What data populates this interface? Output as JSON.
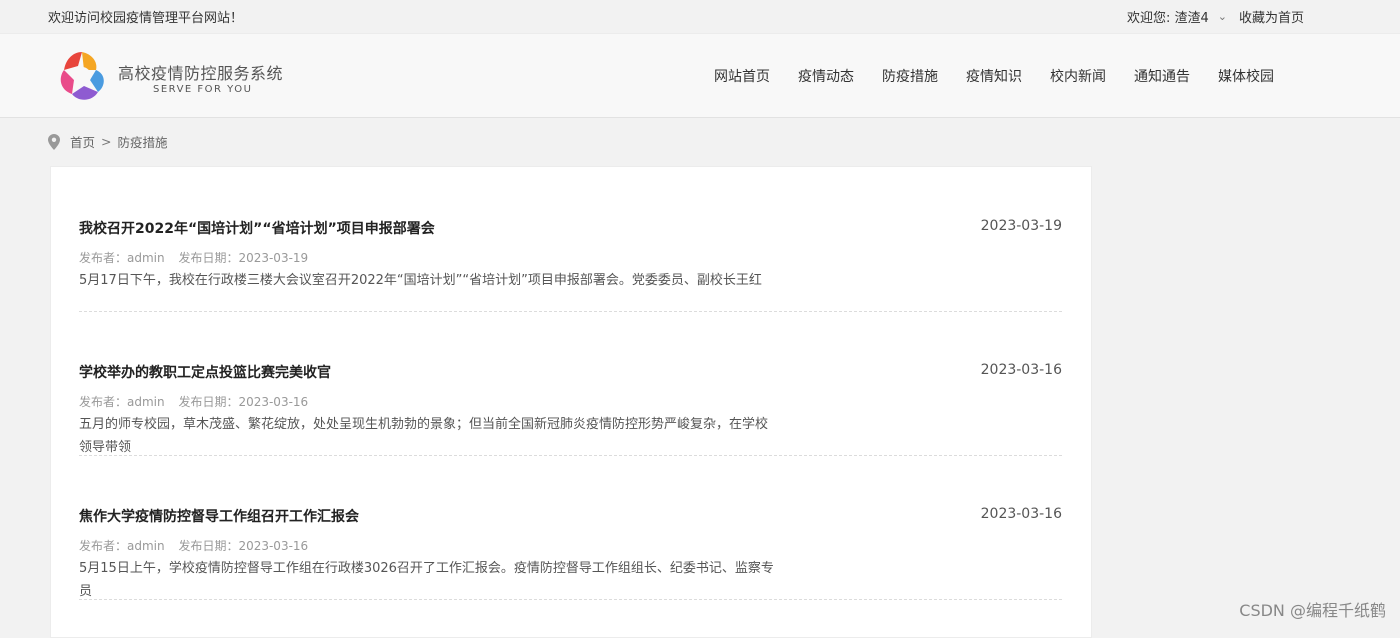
{
  "topbar": {
    "welcome": "欢迎访问校园疫情管理平台网站！",
    "user_greeting": "欢迎您: 渣渣4",
    "favorite": "收藏为首页"
  },
  "brand": {
    "title": "高校疫情防控服务系统",
    "subtitle": "SERVE FOR YOU"
  },
  "nav": {
    "items": [
      "网站首页",
      "疫情动态",
      "防疫措施",
      "疫情知识",
      "校内新闻",
      "通知通告",
      "媒体校园"
    ]
  },
  "breadcrumb": {
    "home": "首页",
    "separator": ">",
    "current": "防疫措施"
  },
  "articles": [
    {
      "title": "我校召开2022年“国培计划”“省培计划”项目申报部署会",
      "date": "2023-03-19",
      "publisher": "发布者：admin",
      "publish_date": "发布日期：2023-03-19",
      "summary": "5月17日下午，我校在行政楼三楼大会议室召开2022年“国培计划”“省培计划”项目申报部署会。党委委员、副校长王红"
    },
    {
      "title": "学校举办的教职工定点投篮比赛完美收官",
      "date": "2023-03-16",
      "publisher": "发布者：admin",
      "publish_date": "发布日期：2023-03-16",
      "summary": "五月的师专校园，草木茂盛、繁花绽放，处处呈现生机勃勃的景象；但当前全国新冠肺炎疫情防控形势严峻复杂，在学校领导带领"
    },
    {
      "title": "焦作大学疫情防控督导工作组召开工作汇报会",
      "date": "2023-03-16",
      "publisher": "发布者：admin",
      "publish_date": "发布日期：2023-03-16",
      "summary": "5月15日上午，学校疫情防控督导工作组在行政楼3026召开了工作汇报会。疫情防控督导工作组组长、纪委书记、监察专员"
    }
  ],
  "watermark": "CSDN @编程千纸鹤",
  "colors": {
    "page_bg": "#f2f2f2",
    "header_bg": "#f8f8f8",
    "panel_bg": "#ffffff",
    "text": "#333333",
    "muted": "#999999"
  }
}
